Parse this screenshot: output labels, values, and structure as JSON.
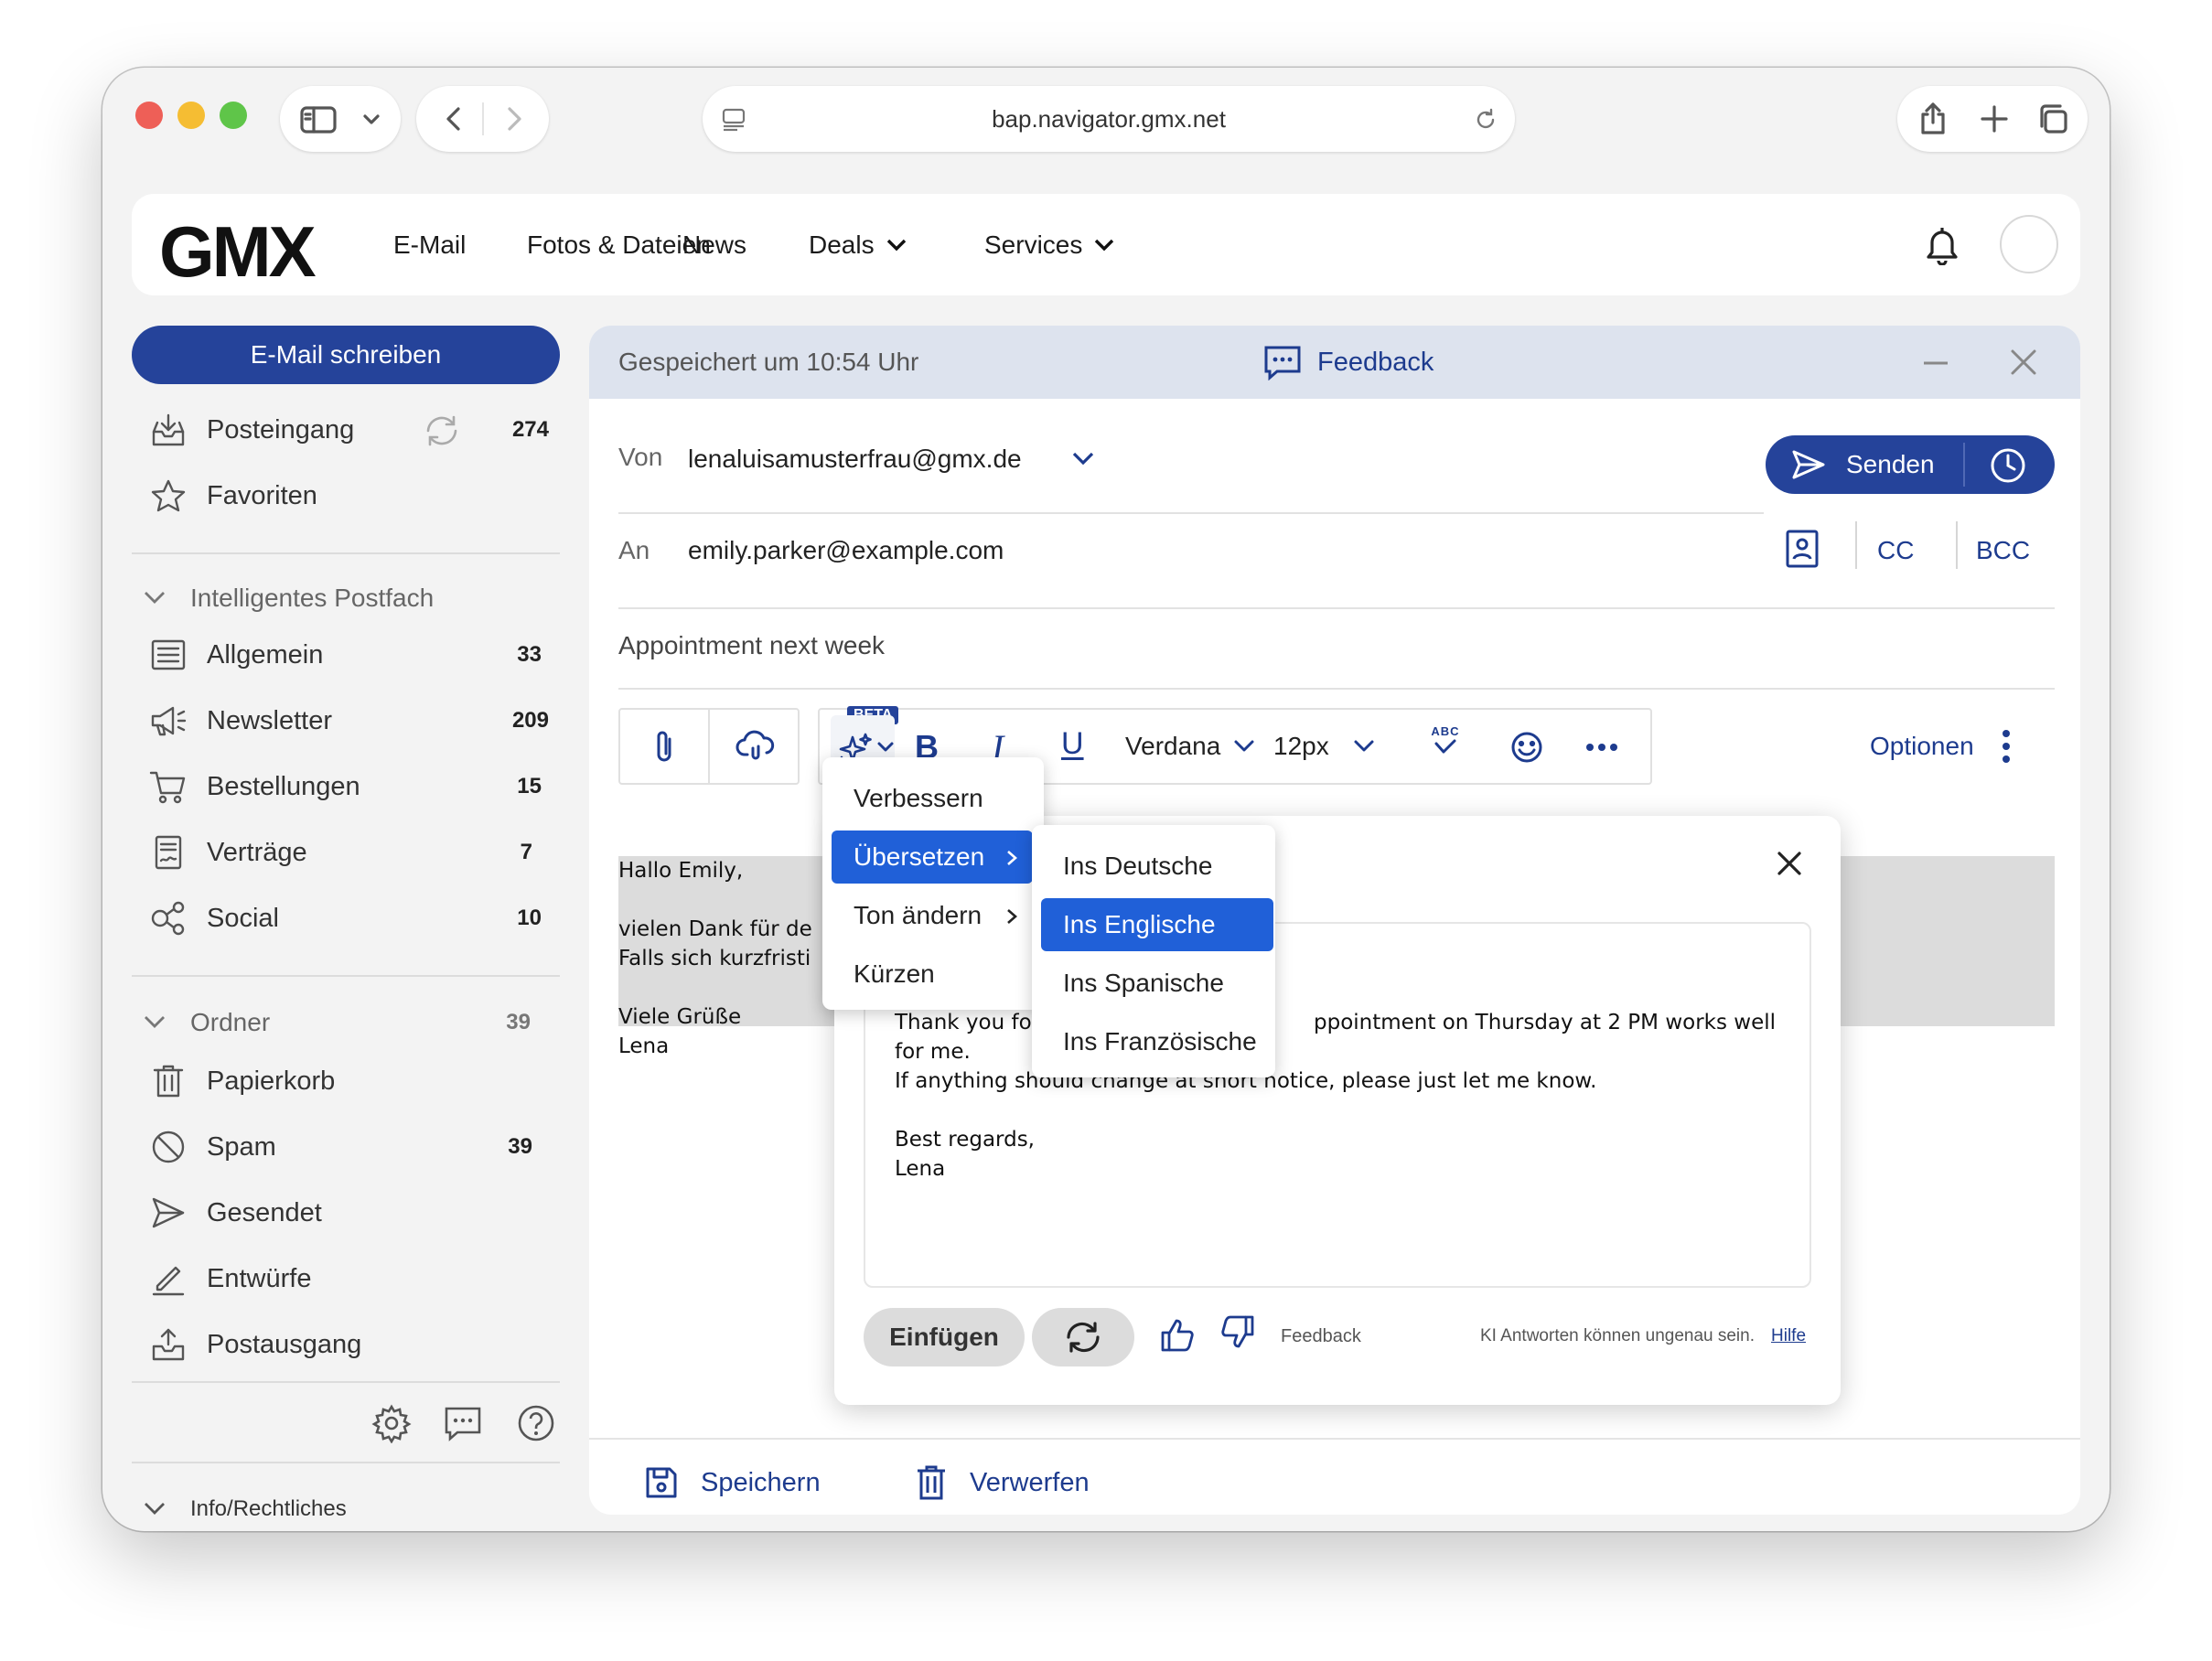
{
  "browser": {
    "url": "bap.navigator.gmx.net"
  },
  "header": {
    "logo": "GMX",
    "nav": [
      "E-Mail",
      "Fotos & Dateien",
      "News",
      "Deals",
      "Services"
    ]
  },
  "sidebar": {
    "compose": "E-Mail schreiben",
    "top_items": [
      {
        "label": "Posteingang",
        "count": "274"
      },
      {
        "label": "Favoriten",
        "count": ""
      }
    ],
    "smart_section": "Intelligentes Postfach",
    "smart_items": [
      {
        "label": "Allgemein",
        "count": "33"
      },
      {
        "label": "Newsletter",
        "count": "209"
      },
      {
        "label": "Bestellungen",
        "count": "15"
      },
      {
        "label": "Verträge",
        "count": "7"
      },
      {
        "label": "Social",
        "count": "10"
      }
    ],
    "folder_section": "Ordner",
    "folder_count": "39",
    "folder_items": [
      {
        "label": "Papierkorb",
        "count": ""
      },
      {
        "label": "Spam",
        "count": "39"
      },
      {
        "label": "Gesendet",
        "count": ""
      },
      {
        "label": "Entwürfe",
        "count": ""
      },
      {
        "label": "Postausgang",
        "count": ""
      }
    ],
    "footer": "Info/Rechtliches"
  },
  "compose": {
    "saved_status": "Gespeichert um 10:54 Uhr",
    "feedback": "Feedback",
    "from_label": "Von",
    "from_value": "lenaluisamusterfrau@gmx.de",
    "send": "Senden",
    "to_label": "An",
    "to_value": "emily.parker@example.com",
    "cc": "CC",
    "bcc": "BCC",
    "subject": "Appointment next week",
    "toolbar": {
      "beta": "BETA",
      "font": "Verdana",
      "size": "12px",
      "abc": "ABC",
      "options": "Optionen"
    },
    "body_lines": [
      "Hallo Emily,",
      "",
      "vielen Dank für de",
      "Falls sich kurzfristi",
      "",
      "Viele Grüße",
      "Lena"
    ],
    "save": "Speichern",
    "discard": "Verwerfen"
  },
  "ai_menu": {
    "items": [
      "Verbessern",
      "Übersetzen",
      "Ton ändern",
      "Kürzen"
    ],
    "selected": "Übersetzen"
  },
  "translate_menu": {
    "items": [
      "Ins Deutsche",
      "Ins Englische",
      "Ins Spanische",
      "Ins Französische"
    ],
    "selected": "Ins Englische"
  },
  "ai_panel": {
    "result_line1_a": "Thank you fo",
    "result_line1_b": "ppointment on Thursday at 2 PM works well",
    "result_line2": "for me.",
    "result_line3": "If anything should change at short notice, please just let me know.",
    "result_line4": "",
    "result_line5": "Best regards,",
    "result_line6": "Lena",
    "insert": "Einfügen",
    "feedback": "Feedback",
    "disclaimer": "KI Antworten können ungenau sein.",
    "help": "Hilfe"
  },
  "colors": {
    "primary": "#25439a",
    "selected": "#2060d8",
    "compose_header": "#dde3ee"
  }
}
